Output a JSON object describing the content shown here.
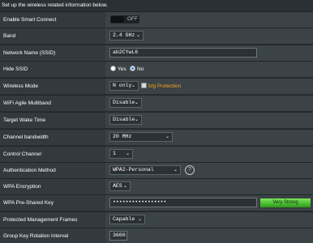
{
  "intro": "Set up the wireless related information below.",
  "rows": [
    {
      "label": "Enable Smart Connect",
      "toggle_text": "OFF"
    },
    {
      "label": "Band",
      "value": "2.4 GHz"
    },
    {
      "label": "Network Name (SSID)",
      "value": "ab2CYwL6"
    },
    {
      "label": "Hide SSID",
      "yes": "Yes",
      "no": "No",
      "selected": "No"
    },
    {
      "label": "Wireless Mode",
      "value": "N only",
      "checkbox_label": "b/g Protection"
    },
    {
      "label": "WiFi Agile Multiband",
      "value": "Disable"
    },
    {
      "label": "Target Wake Time",
      "value": "Disable"
    },
    {
      "label": "Channel bandwidth",
      "value": "20 MHz"
    },
    {
      "label": "Control Channel",
      "value": "1"
    },
    {
      "label": "Authentication Method",
      "value": "WPA2-Personal",
      "help": "?"
    },
    {
      "label": "WPA Encryption",
      "value": "AES"
    },
    {
      "label": "WPA Pre-Shared Key",
      "value": "•••••••••••••••••",
      "strength": "Very Strong",
      "strength_level": 1.0
    },
    {
      "label": "Protected Management Frames",
      "value": "Capable"
    },
    {
      "label": "Group Key Rotation Interval",
      "value": "3600"
    }
  ],
  "colors": {
    "strength": "#2b9a19",
    "protection_label": "#f7a51e",
    "radio_selected": "#2f7ddb"
  }
}
